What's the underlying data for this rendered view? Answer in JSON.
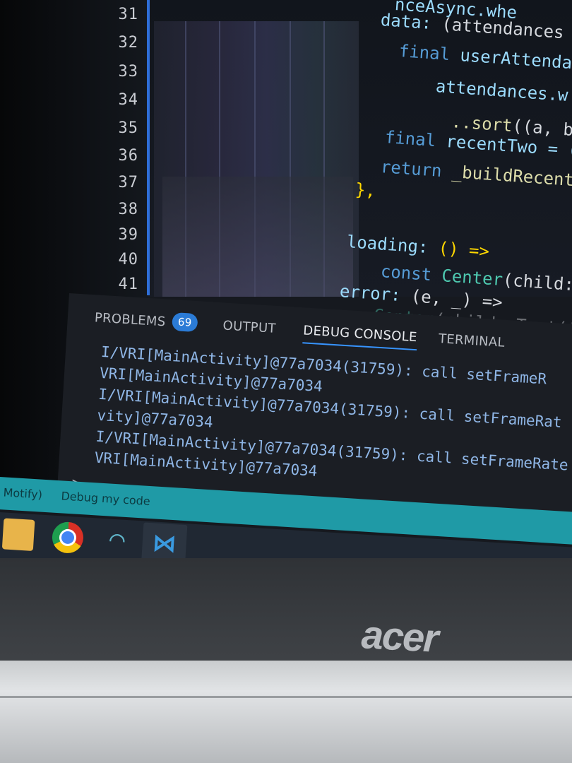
{
  "editor": {
    "line_numbers": [
      "31",
      "32",
      "33",
      "34",
      "35",
      "36",
      "37",
      "38",
      "39",
      "40",
      "41"
    ],
    "code": {
      "l31": "nceAsync.whe",
      "l32_kw": "data:",
      "l32_rest": "(attendances",
      "l33_kw": "final",
      "l33_rest": "userAttenda",
      "l34": "attendances.w",
      "l35_fn": "..sort",
      "l35_rest": "((a, b",
      "l36_kw": "final",
      "l36_rest": "recentTwo = (",
      "l37_kw": "return",
      "l37_fn": "_buildRecent",
      "l38": "},",
      "l40_prop": "loading:",
      "l40_rest": "() =>",
      "l41_kw": "const",
      "l41_cls": "Center",
      "l41_rest": "(child:",
      "l42_prop": "error:",
      "l42_rest": "(e, _) =>",
      "l43_cls": "Center",
      "l43_rest": "(child: Text('E"
    }
  },
  "panel": {
    "tabs": {
      "problems": "PROBLEMS",
      "problems_count": "69",
      "output": "OUTPUT",
      "debug_console": "DEBUG CONSOLE",
      "terminal": "TERMINAL"
    },
    "log_lines": [
      "I/VRI[MainActivity]@77a7034(31759): call setFrameR",
      "VRI[MainActivity]@77a7034",
      "I/VRI[MainActivity]@77a7034(31759): call setFrameRat",
      "vity]@77a7034",
      "I/VRI[MainActivity]@77a7034(31759): call setFrameRate",
      "VRI[MainActivity]@77a7034"
    ],
    "prompt": ">"
  },
  "statusbar": {
    "left": "Motify)",
    "debug_label": "Debug my code"
  },
  "bezel": {
    "brand": "acer"
  },
  "colors": {
    "status_bar": "#1f9aa6",
    "accent": "#3794ff",
    "badge": "#2b7bd6"
  },
  "icons": [
    "folder-icon",
    "chrome-icon",
    "wifi-app-icon",
    "vscode-icon"
  ]
}
